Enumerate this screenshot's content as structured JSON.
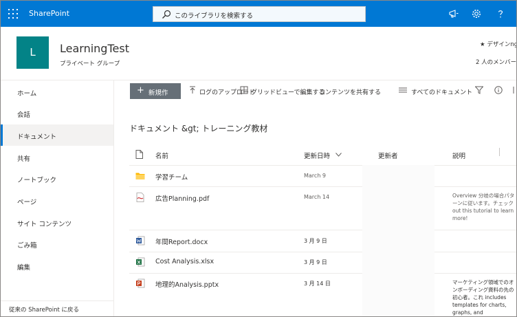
{
  "suitebar": {
    "brand": "SharePoint",
    "search_placeholder": "このライブラリを検索する"
  },
  "header": {
    "logo_letter": "L",
    "title": "LearningTest",
    "subtitle": "プライベート グループ",
    "design_link": "デザインng",
    "members": "2 人のメンバー"
  },
  "nav": {
    "items": [
      {
        "label": "ホーム"
      },
      {
        "label": "会話"
      },
      {
        "label": "ドキュメント"
      },
      {
        "label": "共有"
      },
      {
        "label": "ノートブック"
      },
      {
        "label": "ページ"
      },
      {
        "label": "サイト コンテンツ"
      },
      {
        "label": "ごみ箱"
      },
      {
        "label": "編集"
      }
    ],
    "classic_link": "従来の SharePoint に戻る"
  },
  "commandbar": {
    "new_label": "新規作",
    "upload": "ログのアップロード",
    "grid_edit": "グリッドビューで編集する",
    "share": "コンテンツを共有する",
    "all_docs": "すべてのドキュメント"
  },
  "main": {
    "breadcrumb": "ドキュメント &gt; トレーニング教材",
    "columns": {
      "name": "名前",
      "modified": "更新日時",
      "modified_by": "更新者",
      "description": "説明"
    },
    "rows": [
      {
        "name": "学習チーム",
        "modified": "March 9",
        "description": ""
      },
      {
        "name": "広告Planning.pdf",
        "modified": "March 14",
        "description": "Overview 分岐の場合パターンに従います。チェック out this tutorial to learn more!"
      },
      {
        "name": "年間Report.docx",
        "modified": "3 月 9 日",
        "description": ""
      },
      {
        "name": "Cost Analysis.xlsx",
        "modified": "3 月 9 日",
        "description": ""
      },
      {
        "name": "地理的Analysis.pptx",
        "modified": "3 月 14 日",
        "description": "マーケティング領域でのオンボーディング資料の先の初心者。これ includes templates for charts, graphs, and"
      }
    ]
  },
  "colors": {
    "suitebar": "#0078d4",
    "logo": "#038387",
    "new_button": "#666f77",
    "folder": "#ffb900",
    "pdf": "#d13438",
    "word": "#2b579a",
    "excel": "#217346",
    "powerpoint": "#c43e1c"
  }
}
